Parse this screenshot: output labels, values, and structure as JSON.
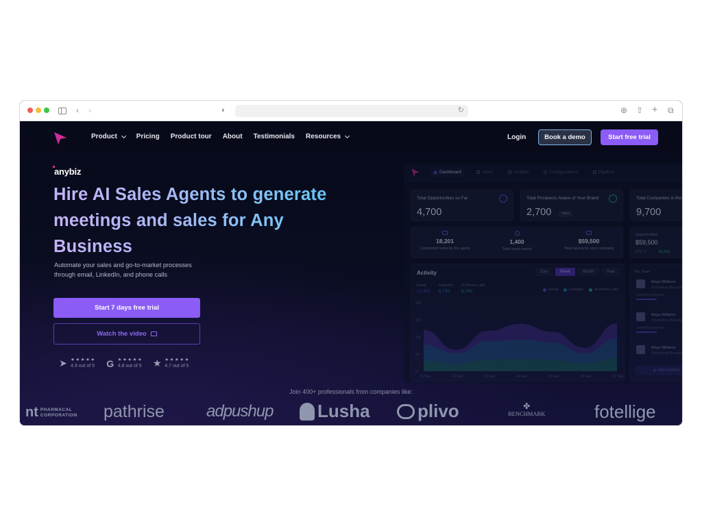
{
  "browser": {
    "traffic_lights": [
      "close",
      "minimize",
      "maximize"
    ],
    "address": ""
  },
  "nav": {
    "links": [
      {
        "label": "Product",
        "has_dropdown": true
      },
      {
        "label": "Pricing",
        "has_dropdown": false
      },
      {
        "label": "Product tour",
        "has_dropdown": false
      },
      {
        "label": "About",
        "has_dropdown": false
      },
      {
        "label": "Testimonials",
        "has_dropdown": false
      },
      {
        "label": "Resources",
        "has_dropdown": true
      }
    ],
    "login": "Login",
    "book_demo": "Book a demo",
    "start_trial": "Start free trial"
  },
  "hero": {
    "brand": "anybiz",
    "headline": "Hire AI Sales Agents to generate meetings and sales for Any Business",
    "subtext": "Automate your sales and go-to-market processes through email, LinkedIn, and phone calls",
    "cta_primary": "Start 7 days free trial",
    "cta_secondary": "Watch the video",
    "ratings": [
      {
        "icon": "capterra-icon",
        "stars": "★★★★★",
        "score": "4.9 out of 5"
      },
      {
        "icon": "g2-icon",
        "stars": "★★★★★",
        "score": "4.8 out of 5"
      },
      {
        "icon": "star-icon",
        "stars": "★★★★★",
        "score": "4.7 out of 5"
      }
    ]
  },
  "dashboard": {
    "tabs": [
      "Dashboard",
      "Inbox",
      "Insights",
      "Configurations",
      "Pipeline"
    ],
    "cards": [
      {
        "label": "Total Opportunities so Far",
        "value": "4,700"
      },
      {
        "label": "Total Prospects Aware of Your Brand",
        "value": "2,700",
        "pill": "View"
      },
      {
        "label": "Total Companies in the",
        "value": "9,700"
      }
    ],
    "stats": [
      {
        "value": "18,201",
        "label": "Completed tasks by the agent"
      },
      {
        "value": "1,400",
        "label": "Total hours saved"
      },
      {
        "value": "$59,500",
        "label": "Total saving for your company"
      }
    ],
    "opportunities": {
      "label": "Opportunities",
      "value": "$59,500",
      "ltv_label": "LTV ↗",
      "ltv_value": "$3,692"
    },
    "activity": {
      "title": "Activity",
      "ranges": [
        "Day",
        "Week",
        "Month",
        "Year"
      ],
      "active_range": "Week",
      "metrics": [
        {
          "label": "Email",
          "value": "21,322",
          "color": "#5b3fc4"
        },
        {
          "label": "LinkedIn",
          "value": "8,740",
          "color": "#1f73a8"
        },
        {
          "label": "AI Phone calls",
          "value": "8,740",
          "color": "#1b9b7a"
        }
      ]
    },
    "team": {
      "title": "My Team",
      "members": [
        {
          "name": "Maya Williams",
          "role": "Marketing Manager",
          "progress_label": "Learning progress",
          "progress": 0.35
        },
        {
          "name": "Maya Williams",
          "role": "Marketing Manager",
          "progress_label": "Learning progress",
          "progress": 0.35
        },
        {
          "name": "Maya Williams",
          "role": "Marketing Manager"
        }
      ],
      "add_label": "Add another"
    }
  },
  "chart_data": {
    "type": "area",
    "title": "Activity",
    "x": [
      "21 Sep",
      "22 Sep",
      "23 Sep",
      "24 Sep",
      "25 Sep",
      "26 Sep",
      "27 Sep"
    ],
    "yticks": [
      0,
      50,
      100,
      150,
      200
    ],
    "ylim": [
      0,
      200
    ],
    "series": [
      {
        "name": "Email",
        "color": "#3a2a7a",
        "values": [
          120,
          62,
          118,
          138,
          115,
          68,
          140
        ]
      },
      {
        "name": "LinkedIn",
        "color": "#1a4a72",
        "values": [
          78,
          52,
          88,
          92,
          84,
          52,
          96
        ]
      },
      {
        "name": "AI Phone calls",
        "color": "#14584e",
        "values": [
          30,
          22,
          34,
          36,
          32,
          22,
          40
        ]
      }
    ],
    "legend": "top-right"
  },
  "social_proof": {
    "label": "Join 400+ professionals from companies like:",
    "companies": [
      "nt PHARMACAL CORPORATION",
      "pathrise",
      "adpushup",
      "Lusha",
      "plivo",
      "BENCHMARK",
      "fotellige"
    ]
  }
}
